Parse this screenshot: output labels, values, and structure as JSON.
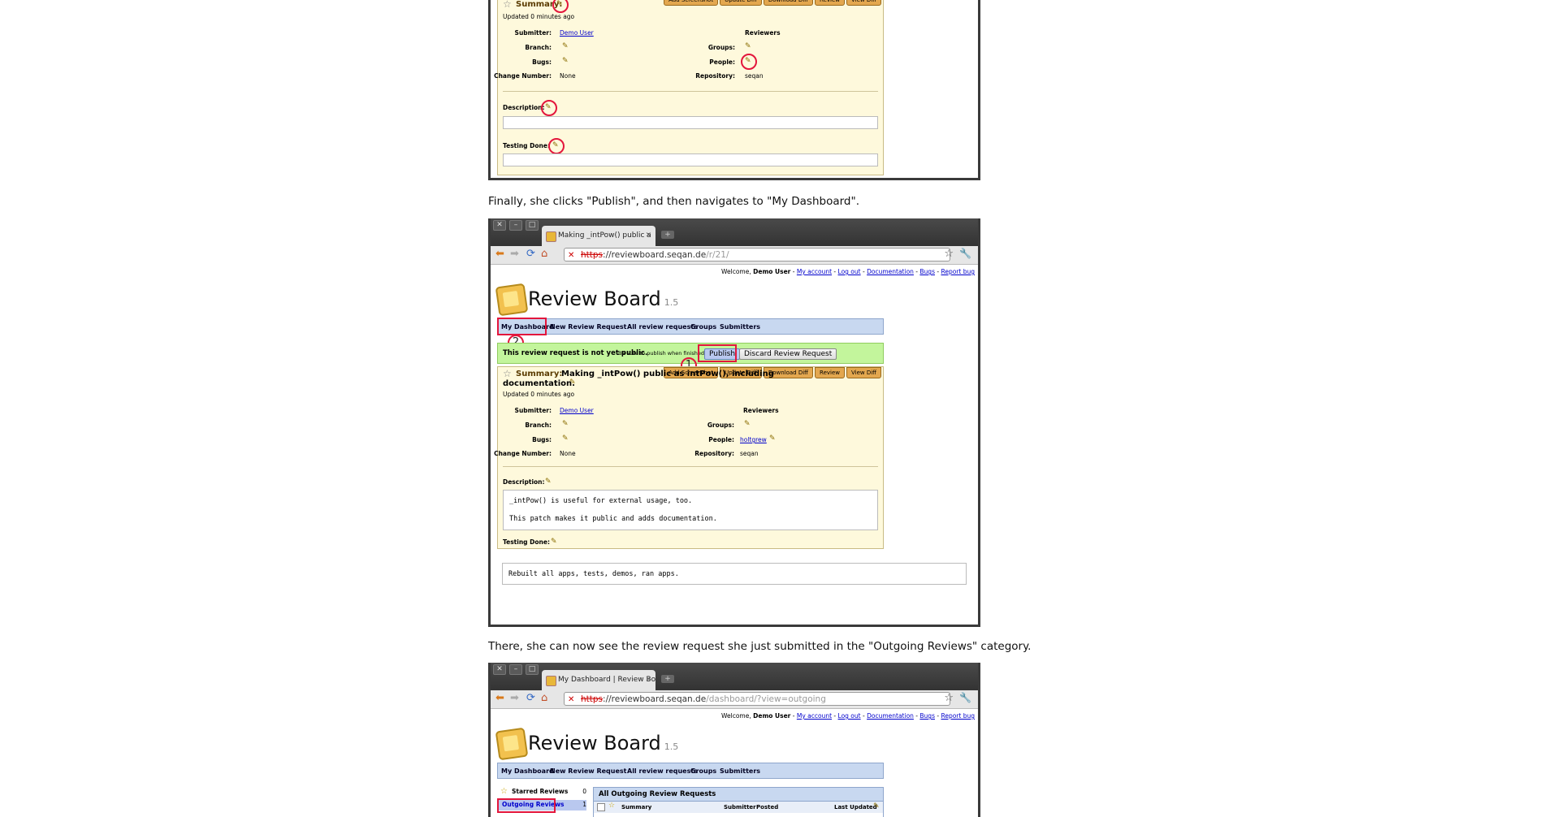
{
  "caption_publish": "Finally, she clicks \"Publish\", and then navigates to \"My Dashboard\".",
  "caption_outgoing": "There, she can now see the review request she just submitted in the \"Outgoing Reviews\" category.",
  "icons": {
    "pencil": "✎",
    "star": "☆",
    "close": "✕",
    "minimize": "–",
    "maximize": "□"
  },
  "browser": {
    "tab1_title": "Making _intPow() public a",
    "tab2_title": "My Dashboard | Review Bo",
    "url_scheme": "https",
    "url_host": "://reviewboard.seqan.de",
    "url_path1": "/r/21/",
    "url_path2": "/dashboard/?view=outgoing"
  },
  "rb": {
    "welcome_text": "Welcome,",
    "user": "Demo User",
    "links": [
      "My account",
      "Log out",
      "Documentation",
      "Bugs",
      "Report bug"
    ],
    "title": "Review Board",
    "version": "1.5",
    "nav": [
      "My Dashboard",
      "New Review Request",
      "-",
      "All review requests",
      "Groups",
      "Submitters"
    ]
  },
  "draft_banner": {
    "message": "This review request is not yet public.",
    "hint": "Be sure to publish when finished.",
    "publish": "Publish",
    "discard": "Discard Review Request"
  },
  "markers": {
    "one": "1",
    "two": "2"
  },
  "review_actions": [
    "Add Screenshot",
    "Update Diff",
    "Download Diff",
    "Review",
    "View Diff"
  ],
  "review": {
    "summary_label": "Summary:",
    "summary_text": "Making _intPow() public as intPow(), including",
    "summary_text2": "documentation.",
    "updated": "Updated 0 minutes ago",
    "submitter_label": "Submitter:",
    "submitter": "Demo User",
    "branch_label": "Branch:",
    "bugs_label": "Bugs:",
    "change_label": "Change Number:",
    "change": "None",
    "reviewers_label": "Reviewers",
    "groups_label": "Groups:",
    "people_label": "People:",
    "people": "holtgrew",
    "repository_label": "Repository:",
    "repository": "seqan",
    "description_label": "Description:",
    "description_lines": [
      "_intPow() is useful for external usage, too.",
      "This patch makes it public and adds documentation."
    ],
    "testing_label": "Testing Done:",
    "testing_lines": [
      "Rebuilt all apps, tests, demos, ran apps."
    ]
  },
  "dashboard": {
    "sidebar": [
      {
        "label": "Starred Reviews",
        "count": "0"
      },
      {
        "label": "Outgoing Reviews",
        "count": "1"
      }
    ],
    "panel_title": "All Outgoing Review Requests",
    "columns": [
      "Summary",
      "Submitter",
      "Posted",
      "Last Updated"
    ]
  }
}
